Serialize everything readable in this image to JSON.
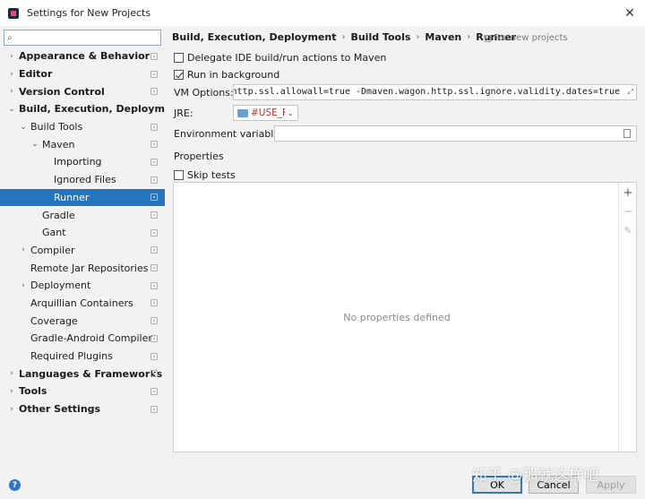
{
  "window": {
    "title": "Settings for New Projects",
    "close_glyph": "✕"
  },
  "sidebar": {
    "search": {
      "value": "",
      "placeholder": ""
    },
    "items": [
      {
        "label": "Appearance & Behavior",
        "arrow": "›",
        "bold": true
      },
      {
        "label": "Editor",
        "arrow": "›",
        "bold": true
      },
      {
        "label": "Version Control",
        "arrow": "›",
        "bold": true
      },
      {
        "label": "Build, Execution, Deployment",
        "arrow": "⌄",
        "bold": true
      },
      {
        "label": "Build Tools",
        "arrow": "⌄",
        "bold": false
      },
      {
        "label": "Maven",
        "arrow": "⌄",
        "bold": false
      },
      {
        "label": "Importing",
        "arrow": "",
        "bold": false
      },
      {
        "label": "Ignored Files",
        "arrow": "",
        "bold": false
      },
      {
        "label": "Runner",
        "arrow": "",
        "bold": false,
        "selected": true
      },
      {
        "label": "Gradle",
        "arrow": "",
        "bold": false
      },
      {
        "label": "Gant",
        "arrow": "",
        "bold": false
      },
      {
        "label": "Compiler",
        "arrow": "›",
        "bold": false
      },
      {
        "label": "Remote Jar Repositories",
        "arrow": "",
        "bold": false
      },
      {
        "label": "Deployment",
        "arrow": "›",
        "bold": false
      },
      {
        "label": "Arquillian Containers",
        "arrow": "",
        "bold": false
      },
      {
        "label": "Coverage",
        "arrow": "",
        "bold": false
      },
      {
        "label": "Gradle-Android Compiler",
        "arrow": "",
        "bold": false
      },
      {
        "label": "Required Plugins",
        "arrow": "",
        "bold": false
      },
      {
        "label": "Languages & Frameworks",
        "arrow": "›",
        "bold": true
      },
      {
        "label": "Tools",
        "arrow": "›",
        "bold": true
      },
      {
        "label": "Other Settings",
        "arrow": "›",
        "bold": true
      }
    ]
  },
  "main": {
    "breadcrumb": [
      "Build, Execution, Deployment",
      "Build Tools",
      "Maven",
      "Runner"
    ],
    "breadcrumb_sep": "›",
    "for_new_projects": "For new projects",
    "delegate": {
      "label": "Delegate IDE build/run actions to Maven",
      "checked": false
    },
    "run_background": {
      "label": "Run in background",
      "checked": true
    },
    "vm_options": {
      "label": "VM Options:",
      "value": "-Dmaven.multiModuleProjectDirectory=$MAVEN_HOME -Dmaven.wagon.http.ssl.insecure=true -Dmaven.wagon.http.ssl.allowall=true -Dmaven.wagon.http.ssl.ignore.validity.dates=true",
      "expand_glyph": "⤢"
    },
    "jre": {
      "label": "JRE:",
      "value": "#USE_PROJECT_JDK",
      "chevron": "⌄"
    },
    "env": {
      "label": "Environment variables:",
      "value": ""
    },
    "properties_title": "Properties",
    "skip_tests": {
      "label": "Skip tests",
      "checked": false
    },
    "properties_empty": "No properties defined",
    "toolbar": {
      "add": "+",
      "remove": "−",
      "edit": "✎"
    }
  },
  "footer": {
    "help": "?",
    "ok": "OK",
    "cancel": "Cancel",
    "apply": "Apply"
  },
  "watermark": "知乎 @那就这样吧"
}
